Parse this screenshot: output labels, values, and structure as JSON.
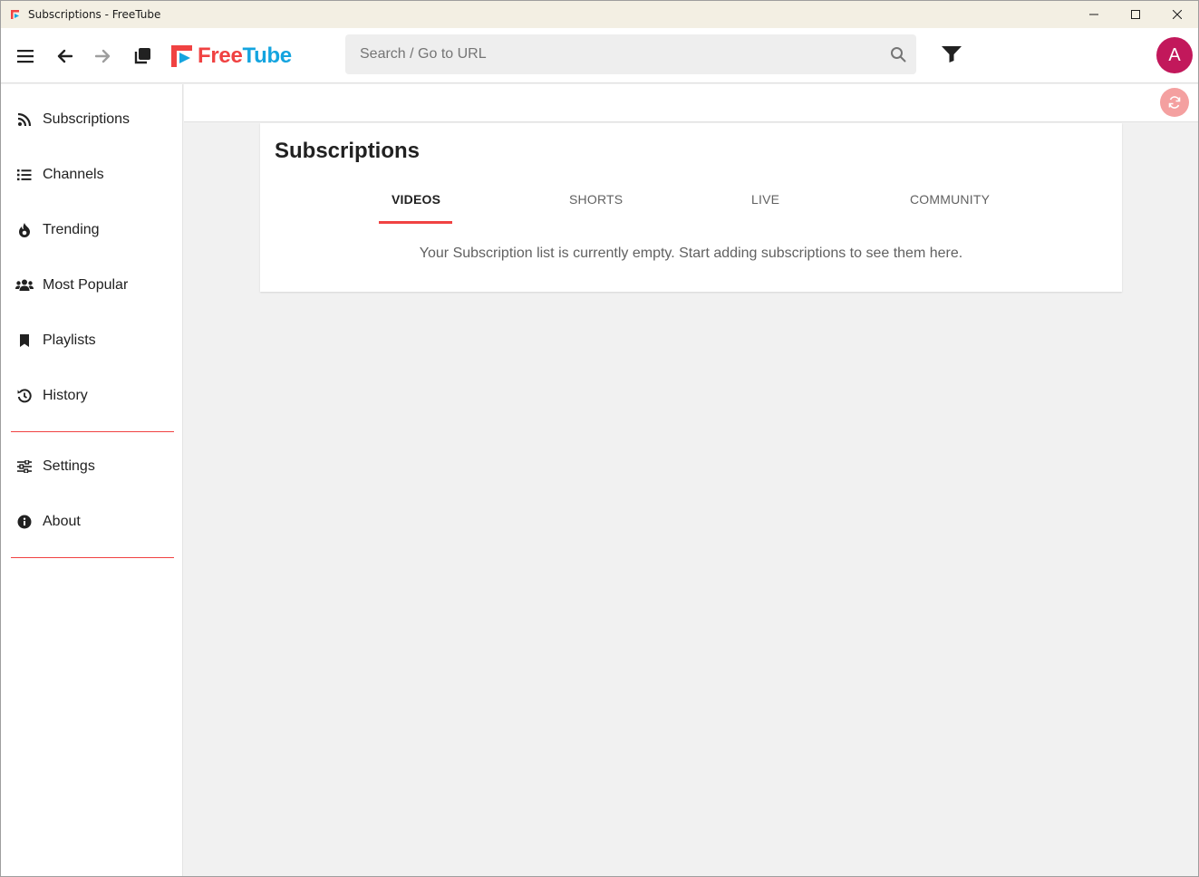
{
  "window": {
    "title": "Subscriptions - FreeTube",
    "controls": [
      "minimize-icon",
      "maximize-icon",
      "close-icon"
    ]
  },
  "topnav": {
    "icons": [
      "menu-icon",
      "back-arrow-icon",
      "forward-arrow-icon",
      "new-window-icon"
    ],
    "logo_free": "Free",
    "logo_tube": "Tube",
    "search_placeholder": "Search / Go to URL",
    "avatar_letter": "A",
    "colors": {
      "brand_red": "#f04242",
      "brand_blue": "#14a4df",
      "avatar": "#c2185b"
    }
  },
  "sidebar": {
    "items": [
      {
        "label": "Subscriptions",
        "icon": "rss-icon"
      },
      {
        "label": "Channels",
        "icon": "list-icon"
      },
      {
        "label": "Trending",
        "icon": "fire-icon"
      },
      {
        "label": "Most Popular",
        "icon": "users-icon"
      },
      {
        "label": "Playlists",
        "icon": "bookmark-icon"
      },
      {
        "label": "History",
        "icon": "history-icon"
      },
      {
        "label": "Settings",
        "icon": "sliders-icon"
      },
      {
        "label": "About",
        "icon": "info-icon"
      }
    ]
  },
  "main": {
    "title": "Subscriptions",
    "tabs": [
      {
        "label": "VIDEOS",
        "active": true
      },
      {
        "label": "SHORTS",
        "active": false
      },
      {
        "label": "LIVE",
        "active": false
      },
      {
        "label": "COMMUNITY",
        "active": false
      }
    ],
    "empty_message": "Your Subscription list is currently empty. Start adding subscriptions to see them here."
  }
}
